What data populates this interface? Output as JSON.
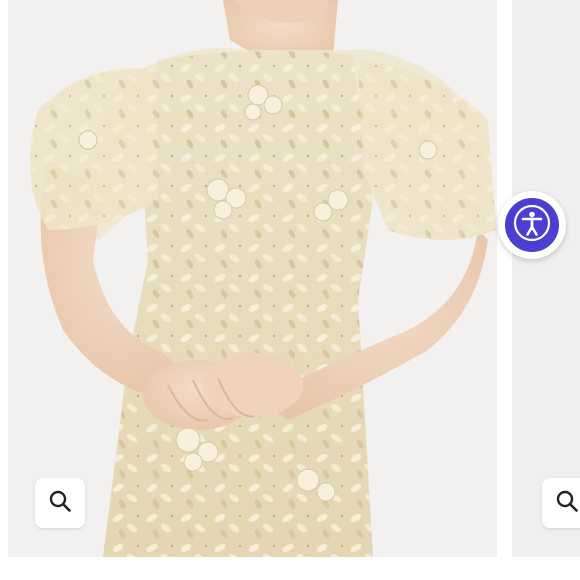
{
  "gallery": {
    "main_image": {
      "alt": "",
      "icon": "dress-photo"
    },
    "zoom_button_icon": "magnifier-icon",
    "next_image": {
      "alt": "",
      "icon": "dress-photo"
    }
  },
  "accessibility_widget": {
    "icon": "accessibility-person-icon",
    "accent_color": "#4a3fd1"
  },
  "colors": {
    "dress": "#e8dcbc",
    "background": "#f2f1ef"
  }
}
